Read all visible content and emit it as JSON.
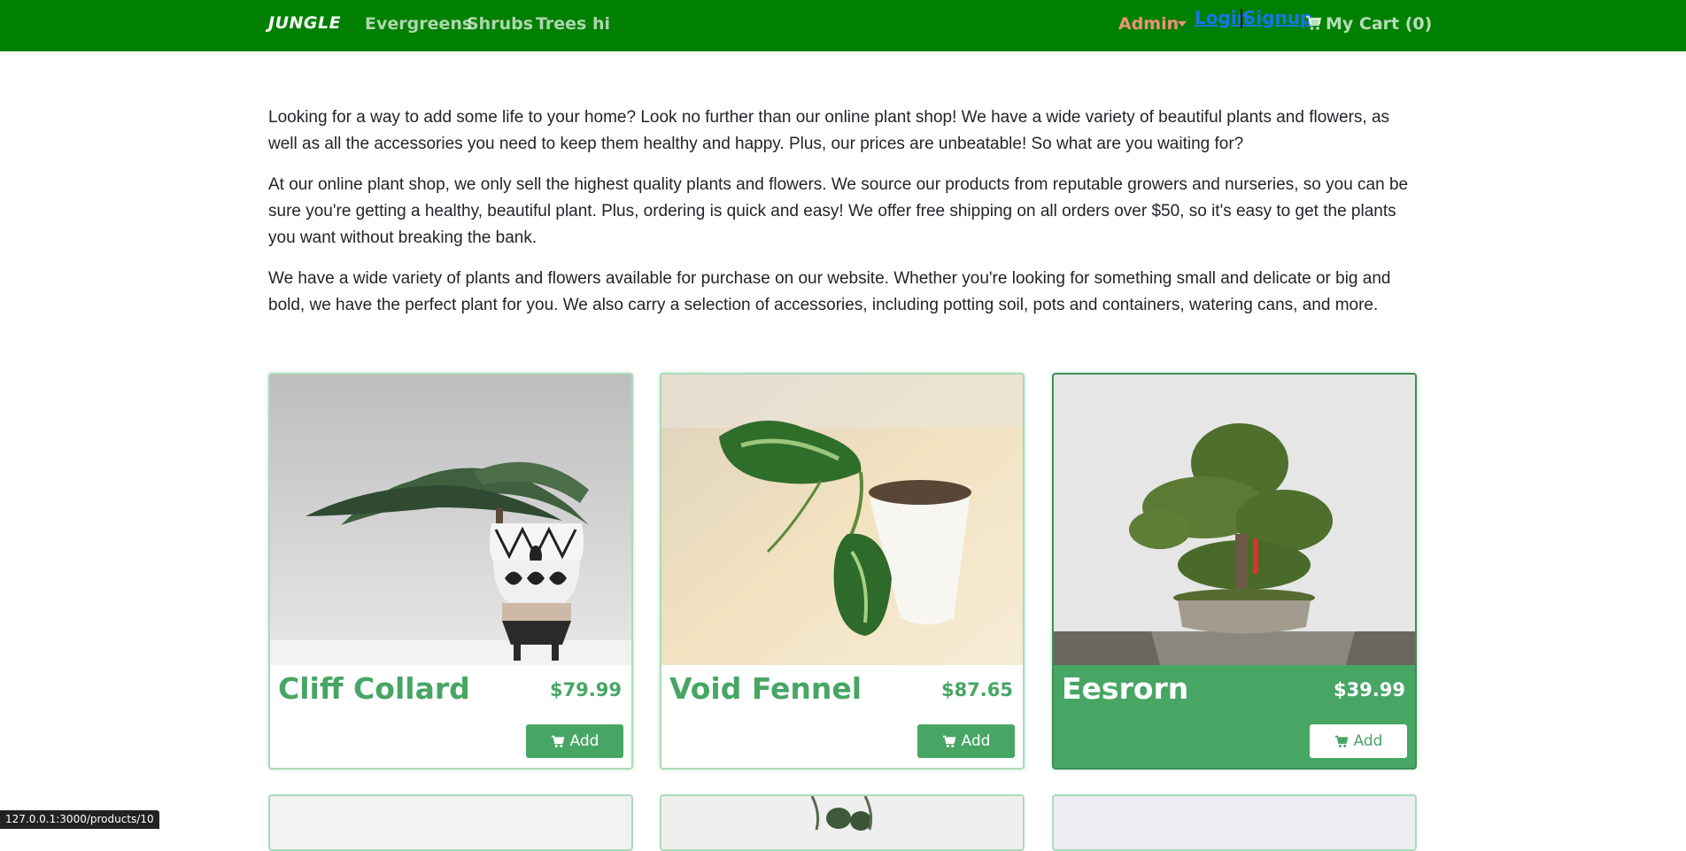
{
  "nav": {
    "brand": "JUNGLE",
    "links": [
      "Evergreens",
      "Shrubs",
      "Trees",
      "hi"
    ],
    "admin": "Admin",
    "login": "Login",
    "signup": "Signup",
    "cart": "My Cart (0)"
  },
  "intro": [
    "Looking for a way to add some life to your home? Look no further than our online plant shop! We have a wide variety of beautiful plants and flowers, as well as all the accessories you need to keep them healthy and happy. Plus, our prices are unbeatable! So what are you waiting for?",
    "At our online plant shop, we only sell the highest quality plants and flowers. We source our products from reputable growers and nurseries, so you can be sure you're getting a healthy, beautiful plant. Plus, ordering is quick and easy! We offer free shipping on all orders over $50, so it's easy to get the plants you want without breaking the bank.",
    "We have a wide variety of plants and flowers available for purchase on our website. Whether you're looking for something small and delicate or big and bold, we have the perfect plant for you. We also carry a selection of accessories, including potting soil, pots and containers, watering cans, and more."
  ],
  "products": [
    {
      "name": "Cliff Collard",
      "price": "$79.99",
      "add_label": "Add"
    },
    {
      "name": "Void Fennel",
      "price": "$87.65",
      "add_label": "Add"
    },
    {
      "name": "Eesrorn",
      "price": "$39.99",
      "add_label": "Add"
    }
  ],
  "status_url": "127.0.0.1:3000/products/10",
  "colors": {
    "navbar": "#008000",
    "accent": "#48a665",
    "admin": "#f0907a",
    "link": "#1a73e8"
  }
}
